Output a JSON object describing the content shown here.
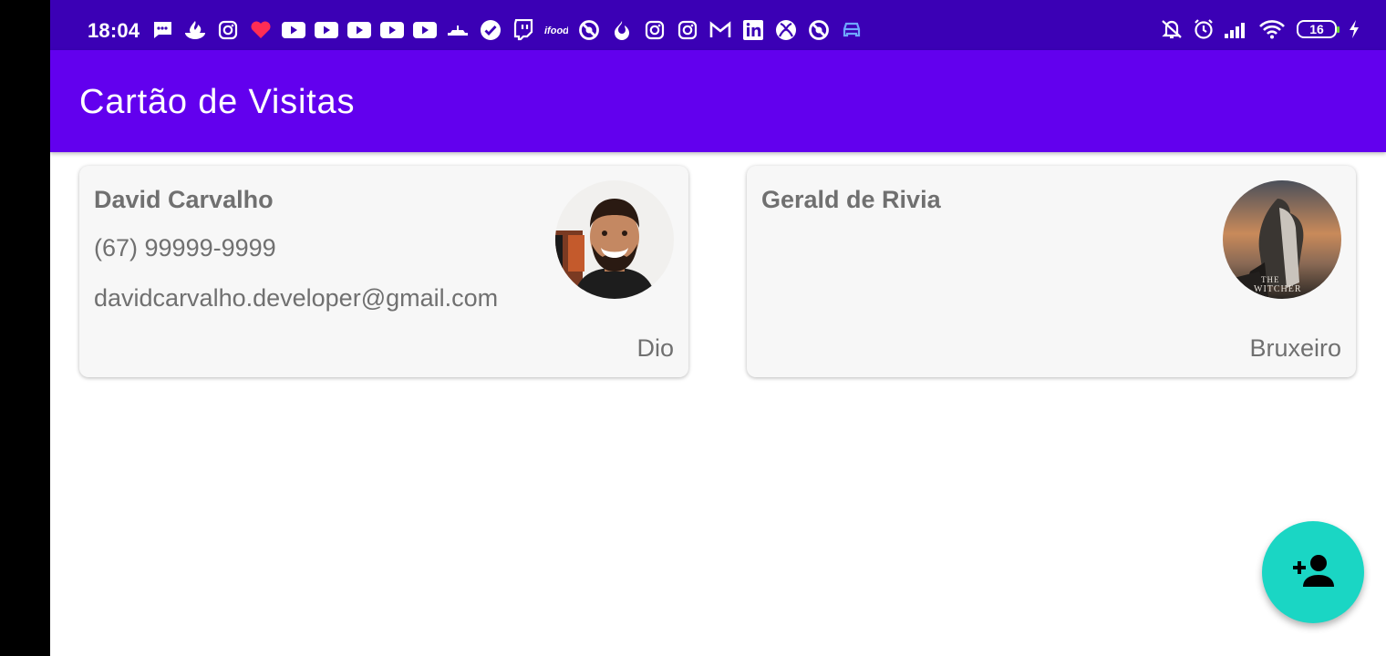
{
  "status_bar": {
    "time": "18:04",
    "battery_level": "16",
    "notification_icons": [
      "message-icon",
      "santander-icon",
      "instagram-icon",
      "heart-icon",
      "youtube-icon",
      "youtube-icon",
      "youtube-icon",
      "youtube-icon",
      "youtube-icon",
      "submarine-icon",
      "check-badge-icon",
      "twitch-icon",
      "ifood-icon",
      "block-icon",
      "fire-icon",
      "instagram-icon",
      "instagram-icon",
      "gmail-icon",
      "linkedin-icon",
      "xbox-icon",
      "block-icon",
      "car-icon"
    ],
    "system_icons": [
      "mute-icon",
      "alarm-icon",
      "signal-icon",
      "wifi-icon",
      "battery-icon",
      "charging-icon"
    ]
  },
  "app_bar": {
    "title": "Cartão de Visitas"
  },
  "cards": [
    {
      "name": "David Carvalho",
      "phone": "(67) 99999-9999",
      "email": "davidcarvalho.developer@gmail.com",
      "company": "Dio"
    },
    {
      "name": "Gerald de Rivia",
      "phone": "",
      "email": "",
      "company": "Bruxeiro"
    }
  ],
  "fab": {
    "icon": "person-add-icon"
  },
  "colors": {
    "status_bar": "#3b00b5",
    "app_bar": "#6200ee",
    "card_background": "#f7f7f7",
    "card_text": "#707070",
    "fab": "#1ad6c4"
  }
}
